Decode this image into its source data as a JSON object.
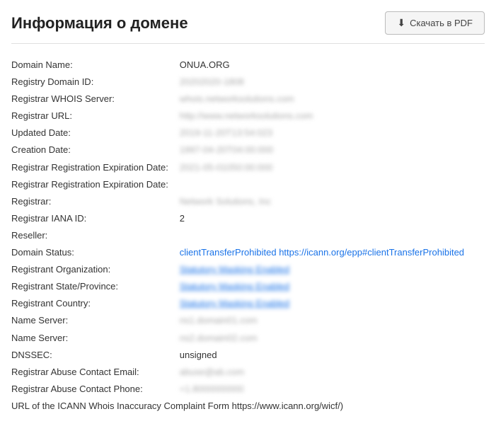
{
  "header": {
    "title": "Информация о домене",
    "download_label": "Скачать в PDF"
  },
  "whois": {
    "fields": [
      {
        "label": "Domain Name:",
        "value": "ONUA.ORG",
        "style": "plain"
      },
      {
        "label": "Registry Domain ID:",
        "value": "20202020-1808",
        "style": "blurred"
      },
      {
        "label": "Registrar WHOIS Server:",
        "value": "whois.networksolutions.com",
        "style": "blurred"
      },
      {
        "label": "Registrar URL:",
        "value": "http://www.networksolutions.com",
        "style": "blurred"
      },
      {
        "label": "Updated Date:",
        "value": "2019-11-20T13:54:023",
        "style": "blurred"
      },
      {
        "label": "Creation Date:",
        "value": "1997-04-20T04:00:000",
        "style": "blurred"
      },
      {
        "label": "Registrar Registration Expiration Date:",
        "value": "2021-05-01050:00:000",
        "style": "blurred"
      },
      {
        "label": "Registrar Registration Expiration Date:",
        "value": "",
        "style": "plain"
      },
      {
        "label": "Registrar:",
        "value": "Network Solutions, Inc",
        "style": "blurred"
      },
      {
        "label": "Registrar IANA ID:",
        "value": "2",
        "style": "plain"
      },
      {
        "label": "Reseller:",
        "value": "",
        "style": "plain"
      },
      {
        "label": "Domain Status:",
        "value": "clientTransferProhibited https://icann.org/epp#clientTransferProhibited",
        "style": "status"
      },
      {
        "label": "Registrant Organization:",
        "value": "Statutory Masking Enabled",
        "style": "link-blue"
      },
      {
        "label": "Registrant State/Province:",
        "value": "Statutory Masking Enabled",
        "style": "link-blue"
      },
      {
        "label": "Registrant Country:",
        "value": "Statutory Masking Enabled",
        "style": "link-blue"
      },
      {
        "label": "Name Server:",
        "value": "ns1.domain01.com",
        "style": "blurred"
      },
      {
        "label": "Name Server:",
        "value": "ns2.domain02.com",
        "style": "blurred"
      },
      {
        "label": "DNSSEC:",
        "value": "unsigned",
        "style": "plain"
      },
      {
        "label": "Registrar Abuse Contact Email:",
        "value": "abuse@ab.com",
        "style": "blurred"
      },
      {
        "label": "Registrar Abuse Contact Phone:",
        "value": "+1.8000000000",
        "style": "blurred"
      },
      {
        "label": "URL of the ICANN Whois Inaccuracy Complaint Form https://www.icann.org/wicf/)",
        "value": "",
        "style": "plain-long"
      }
    ]
  }
}
